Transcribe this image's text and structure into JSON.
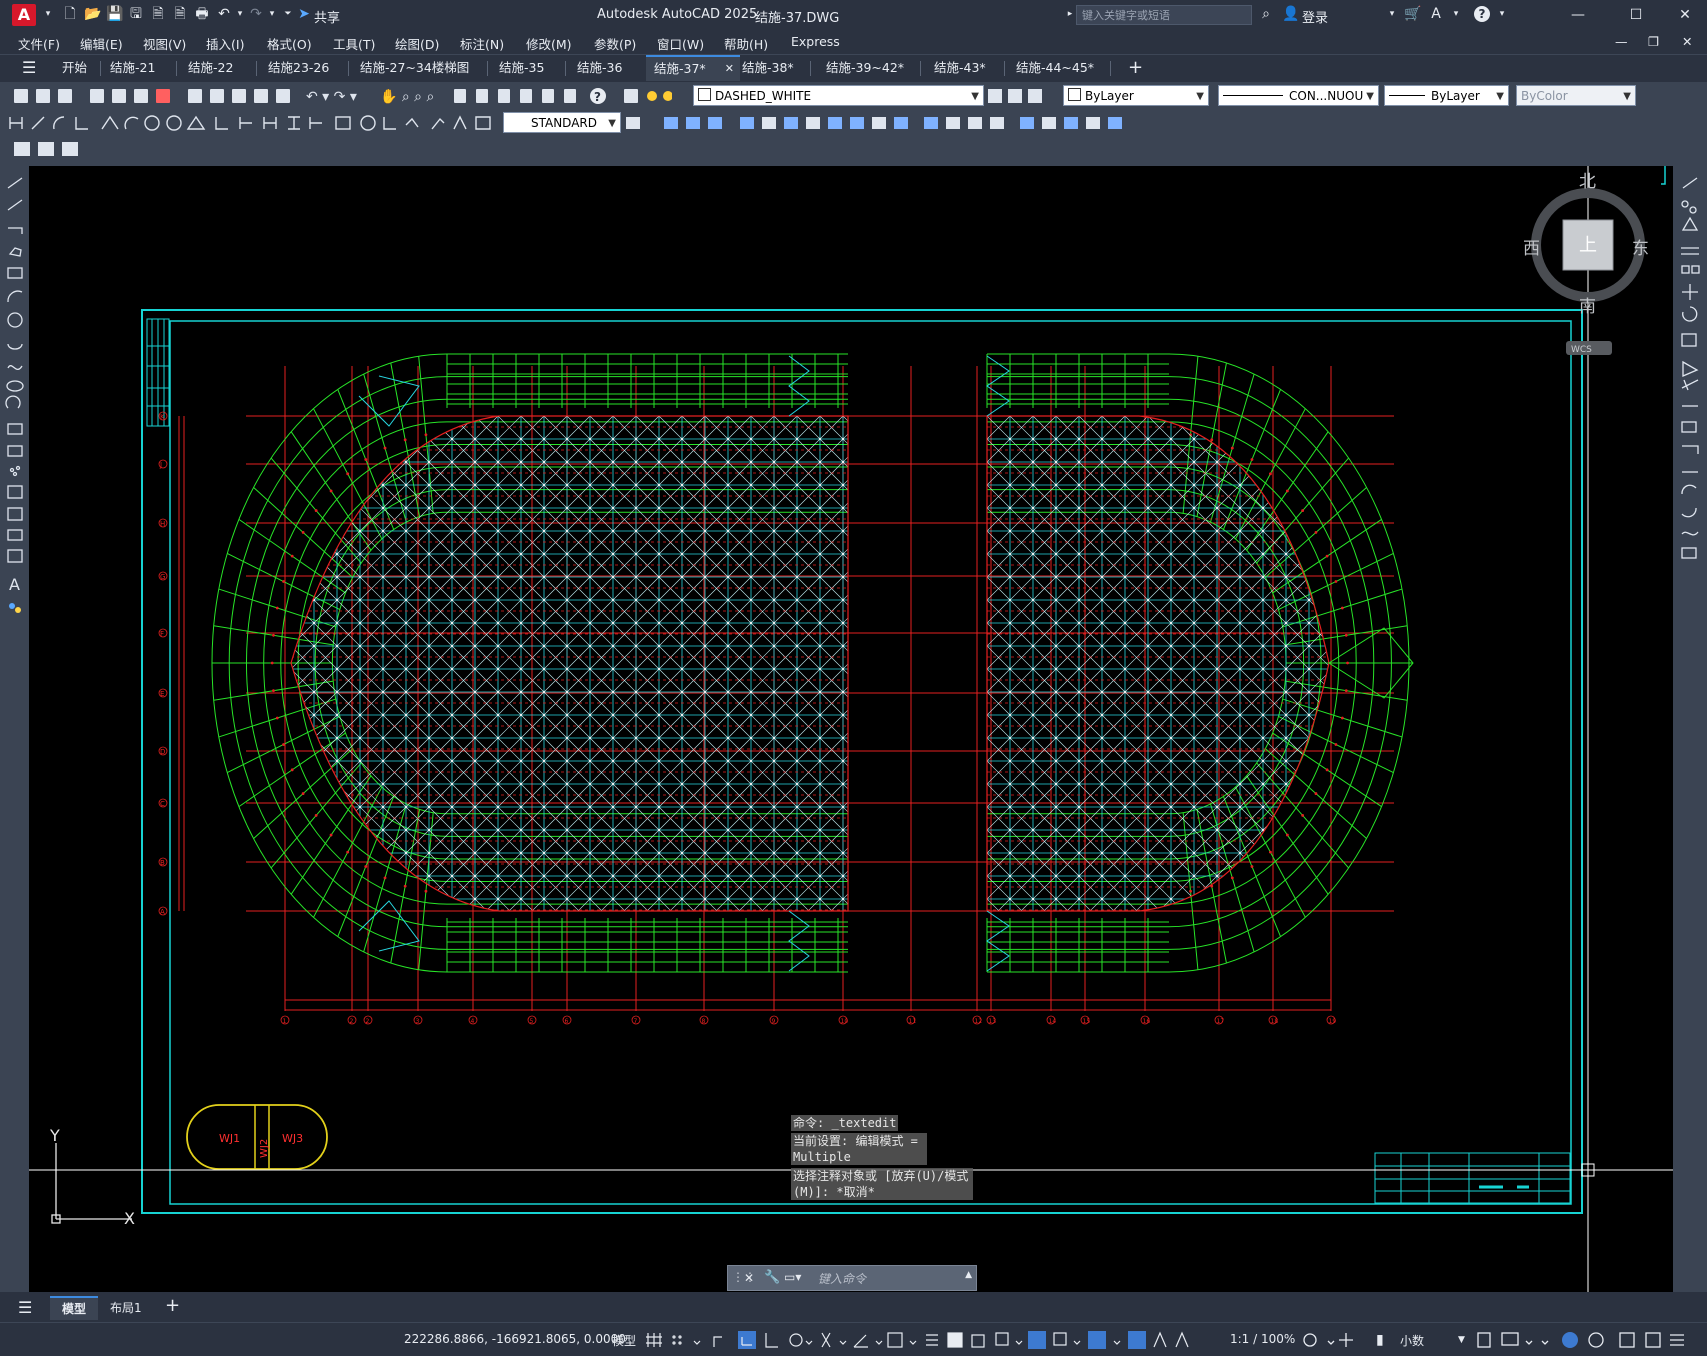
{
  "app": {
    "title": "Autodesk AutoCAD 2025",
    "filename": "结施-37.DWG",
    "logo_letter": "A",
    "share_label": "共享",
    "search_placeholder": "键入关键字或短语",
    "login_label": "登录",
    "help_label": "?"
  },
  "menus": [
    "文件(F)",
    "编辑(E)",
    "视图(V)",
    "插入(I)",
    "格式(O)",
    "工具(T)",
    "绘图(D)",
    "标注(N)",
    "修改(M)",
    "参数(P)",
    "窗口(W)",
    "帮助(H)",
    "Express"
  ],
  "tabs": {
    "start": "开始",
    "items": [
      "结施-21",
      "结施-22",
      "结施23-26",
      "结施-27~34楼梯图",
      "结施-35",
      "结施-36",
      "结施-37*",
      "结施-38*",
      "结施-39~42*",
      "结施-43*",
      "结施-44~45*"
    ],
    "active_index": 6,
    "add_label": "+"
  },
  "toolbar": {
    "layer_name": "DASHED_WHITE",
    "color": "ByLayer",
    "linetype": "CON...NUOU",
    "lineweight": "ByLayer",
    "plotstyle": "ByColor",
    "dimstyle": "STANDARD"
  },
  "viewcube": {
    "north": "北",
    "south": "南",
    "east": "东",
    "west": "西",
    "top": "上",
    "wcs": "WCS"
  },
  "drawing": {
    "axis_rows": [
      "K",
      "J",
      "H",
      "G",
      "F",
      "E",
      "D",
      "C",
      "B",
      "A"
    ],
    "axis_cols": [
      "1",
      "2",
      "2",
      "3",
      "4",
      "5",
      "6",
      "7",
      "8",
      "9",
      "10",
      "11",
      "12",
      "13",
      "14",
      "15",
      "16",
      "17",
      "18",
      "19"
    ],
    "legend_left": "WJ1",
    "legend_mid": "WJ2",
    "legend_right": "WJ3",
    "ucs_x": "X",
    "ucs_y": "Y"
  },
  "command": {
    "history": [
      "命令: _textedit",
      "当前设置: 编辑模式 = Multiple",
      "选择注释对象或 [放弃(U)/模式(M)]: *取消*"
    ],
    "placeholder": "键入命令"
  },
  "layout_tabs": {
    "model": "模型",
    "layout1": "布局1",
    "add": "+"
  },
  "status": {
    "coordinates": "222286.8866, -166921.8065, 0.0000",
    "space": "模型",
    "scale": "1:1 / 100%",
    "units": "小数"
  }
}
